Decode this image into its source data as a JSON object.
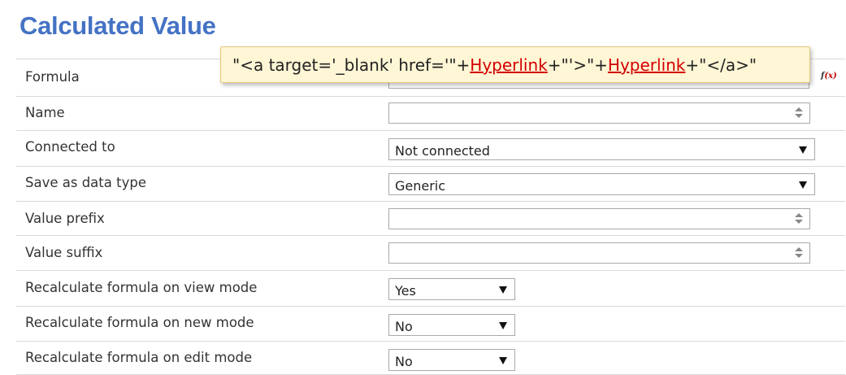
{
  "title": "Calculated Value",
  "tooltip": {
    "seg1": "\"<a target='_blank' href='\"+",
    "link1": "Hyperlink",
    "seg2": "+\"'>\"+",
    "link2": "Hyperlink",
    "seg3": "+\"</a>\""
  },
  "fx_icon": {
    "f": "f",
    "x": "(x)"
  },
  "rows": {
    "formula": {
      "label": "Formula",
      "value": ""
    },
    "name": {
      "label": "Name",
      "value": ""
    },
    "connected_to": {
      "label": "Connected to",
      "selected": "Not connected"
    },
    "save_as_data_type": {
      "label": "Save as data type",
      "selected": "Generic"
    },
    "value_prefix": {
      "label": "Value prefix",
      "value": ""
    },
    "value_suffix": {
      "label": "Value suffix",
      "value": ""
    },
    "recalc_view": {
      "label": "Recalculate formula on view mode",
      "selected": "Yes"
    },
    "recalc_new": {
      "label": "Recalculate formula on new mode",
      "selected": "No"
    },
    "recalc_edit": {
      "label": "Recalculate formula on edit mode",
      "selected": "No"
    }
  },
  "colors": {
    "title": "#4472c4",
    "tooltip_bg": "#fff6d5",
    "link": "#d40000",
    "divider": "#d9d9d9"
  }
}
